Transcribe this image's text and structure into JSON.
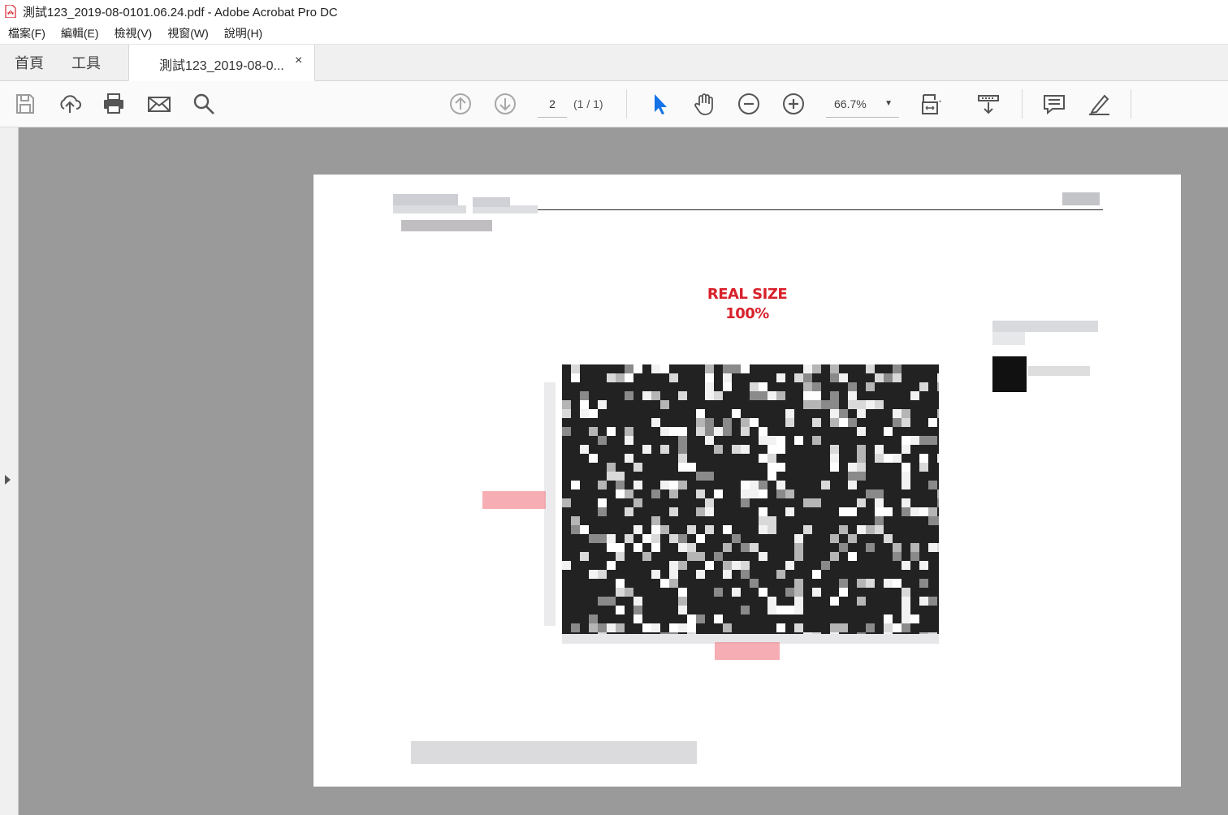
{
  "window": {
    "title": "測試123_2019-08-0101.06.24.pdf - Adobe Acrobat Pro DC"
  },
  "menu": {
    "items": [
      "檔案(F)",
      "編輯(E)",
      "檢視(V)",
      "視窗(W)",
      "說明(H)"
    ]
  },
  "tabs": {
    "home": "首頁",
    "tools": "工具",
    "document": "測試123_2019-08-0...",
    "close": "×"
  },
  "toolbar": {
    "page_number": "2",
    "page_count": "(1 / 1)",
    "zoom": "66.7%",
    "icons": [
      "save-icon",
      "upload-icon",
      "print-icon",
      "email-icon",
      "search-icon",
      "prev-page-icon",
      "next-page-icon",
      "select-cursor-icon",
      "hand-icon",
      "zoom-out-icon",
      "zoom-in-icon",
      "fit-page-icon",
      "scroll-mode-icon",
      "comment-icon",
      "sign-icon"
    ]
  },
  "document": {
    "headline_1": "REAL SIZE",
    "headline_2": "100%",
    "accent_color": "#d8212b"
  }
}
